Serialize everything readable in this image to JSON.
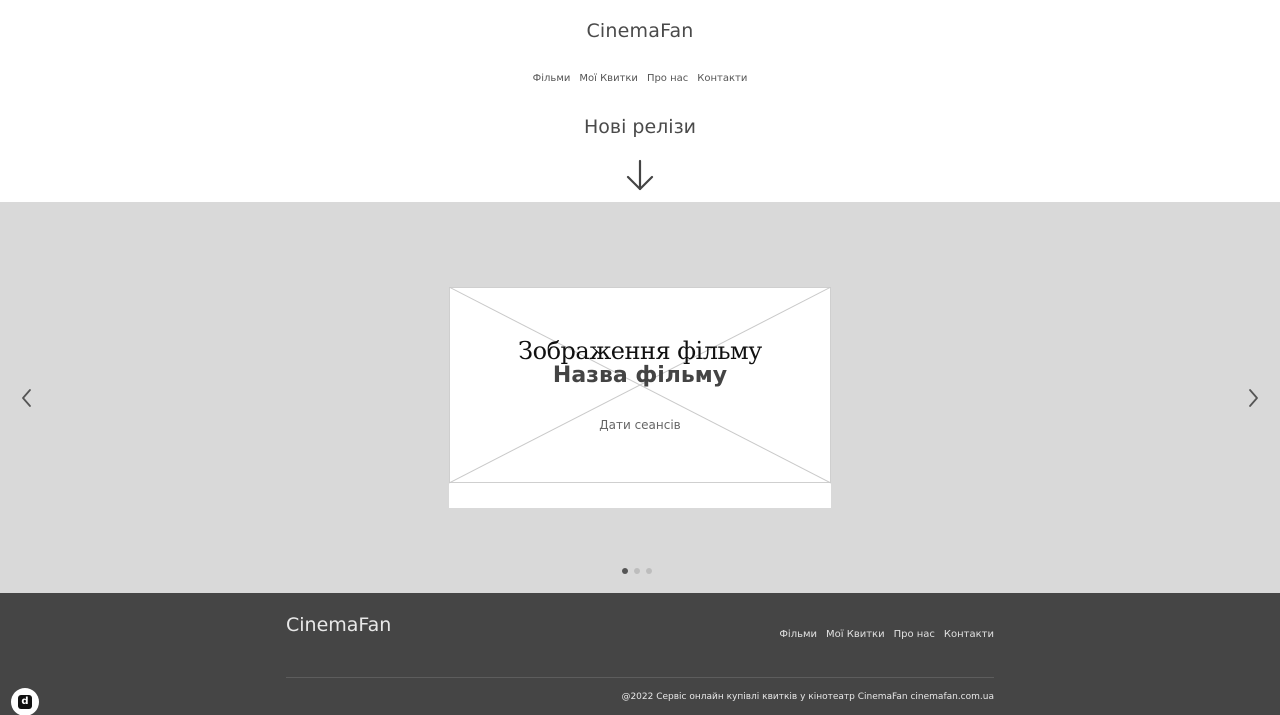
{
  "header": {
    "brand": "CinemaFan",
    "nav": [
      "Фільми",
      "Мої Квитки",
      "Про нас",
      "Контакти"
    ],
    "section_title": "Нові релізи"
  },
  "carousel": {
    "slide": {
      "image_alt": "Зображення фільму",
      "title": "Назва фільму",
      "dates": "Дати сеансів"
    },
    "slides_count": 3,
    "active_index": 0
  },
  "footer": {
    "brand": "CinemaFan",
    "nav": [
      "Фільми",
      "Мої Квитки",
      "Про нас",
      "Контакти"
    ],
    "copyright": "@2022 Сервіс онлайн купівлі квитків у кінотеатр CinemaFan cinemafan.com.ua"
  },
  "badge": {
    "icon": "d-app-icon",
    "glyph": "d"
  },
  "colors": {
    "carousel_bg": "#d9d9d9",
    "footer_bg": "#454545",
    "text_dark": "#4a4a4a"
  }
}
